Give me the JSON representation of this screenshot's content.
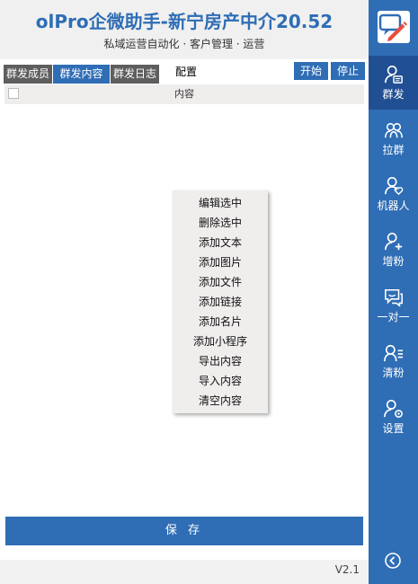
{
  "header": {
    "title": "olPro企微助手-新宁房产中介20.52",
    "subtitle": "私域运营自动化 · 客户管理 · 运营"
  },
  "tabs": [
    {
      "label": "群发成员"
    },
    {
      "label": "群发内容"
    },
    {
      "label": "群发日志"
    }
  ],
  "toolbar": {
    "config_label": "配置",
    "start_label": "开始",
    "stop_label": "停止"
  },
  "table": {
    "column_header": "内容"
  },
  "context_menu": {
    "items": [
      "编辑选中",
      "删除选中",
      "添加文本",
      "添加图片",
      "添加文件",
      "添加链接",
      "添加名片",
      "添加小程序",
      "导出内容",
      "导入内容",
      "清空内容"
    ]
  },
  "footer": {
    "save_label": "保 存",
    "version": "V2.1"
  },
  "sidebar": {
    "items": [
      {
        "label": "群发",
        "icon": "broadcast-user-icon"
      },
      {
        "label": "拉群",
        "icon": "group-icon"
      },
      {
        "label": "机器人",
        "icon": "robot-user-icon"
      },
      {
        "label": "增粉",
        "icon": "add-user-icon"
      },
      {
        "label": "一对一",
        "icon": "chat-icon"
      },
      {
        "label": "清粉",
        "icon": "user-list-icon"
      },
      {
        "label": "设置",
        "icon": "user-settings-icon"
      }
    ]
  },
  "colors": {
    "accent": "#2f6db5",
    "accent_dark": "#214f93",
    "tab_inactive": "#5e5e5e"
  }
}
